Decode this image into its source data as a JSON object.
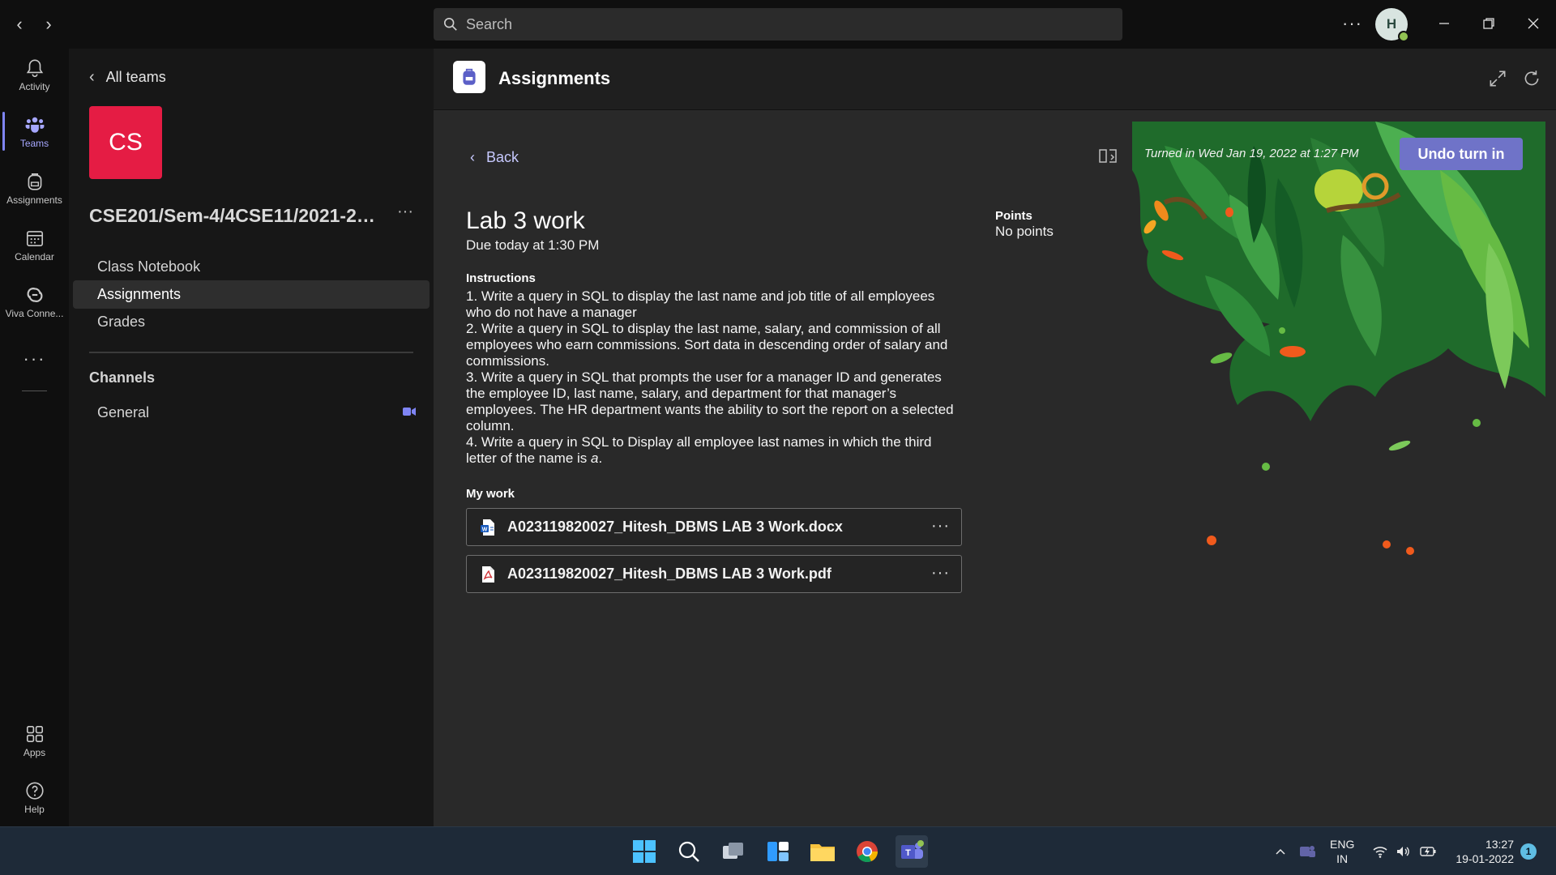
{
  "titlebar": {
    "search_placeholder": "Search",
    "avatar_initial": "H"
  },
  "rail": {
    "items": [
      {
        "label": "Activity",
        "icon": "bell-icon"
      },
      {
        "label": "Teams",
        "icon": "teams-icon"
      },
      {
        "label": "Assignments",
        "icon": "backpack-icon"
      },
      {
        "label": "Calendar",
        "icon": "calendar-icon"
      },
      {
        "label": "Viva Conne...",
        "icon": "viva-icon"
      },
      {
        "label": "Apps",
        "icon": "apps-icon"
      },
      {
        "label": "Help",
        "icon": "help-icon"
      }
    ],
    "more_label": "···"
  },
  "team_pane": {
    "all_teams": "All teams",
    "tile_text": "CS",
    "team_name": "CSE201/Sem-4/4CSE11/2021-20...",
    "more_label": "···",
    "nav": [
      "Class Notebook",
      "Assignments",
      "Grades"
    ],
    "channels_heading": "Channels",
    "channels": [
      "General"
    ]
  },
  "main": {
    "app_title": "Assignments",
    "back_label": "Back",
    "turned_in": "Turned in Wed Jan 19, 2022 at 1:27 PM",
    "undo_label": "Undo turn in",
    "title": "Lab 3 work",
    "due": "Due today at 1:30 PM",
    "points_label": "Points",
    "points_value": "No points",
    "instructions_label": "Instructions",
    "instructions": [
      "1. Write a query in SQL to display the last name and job title of all employees who do not have a manager",
      "2. Write a query in SQL to display the last name, salary, and commission of all employees who earn commissions. Sort data in descending order of salary and commissions.",
      "3. Write a query in SQL that prompts the user for a manager ID and generates the employee ID, last name, salary, and department for that manager’s employees. The HR department wants the ability to sort the report on a selected column.",
      "4. Write a query in SQL to Display all employee last names in which the third letter of the name is "
    ],
    "instruction_emphasis": "a",
    "instruction_end": ".",
    "my_work_label": "My work",
    "files": [
      {
        "name": "A023119820027_Hitesh_DBMS LAB 3 Work.docx",
        "icon": "word-file-icon"
      },
      {
        "name": "A023119820027_Hitesh_DBMS LAB 3 Work.pdf",
        "icon": "pdf-file-icon"
      }
    ],
    "file_more": "···"
  },
  "taskbar": {
    "lang_top": "ENG",
    "lang_bottom": "IN",
    "time": "13:27",
    "date": "19-01-2022",
    "notification_count": "1"
  },
  "colors": {
    "accent": "#6f73c8",
    "team_tile": "#e51c44",
    "status_available": "#92c353"
  }
}
